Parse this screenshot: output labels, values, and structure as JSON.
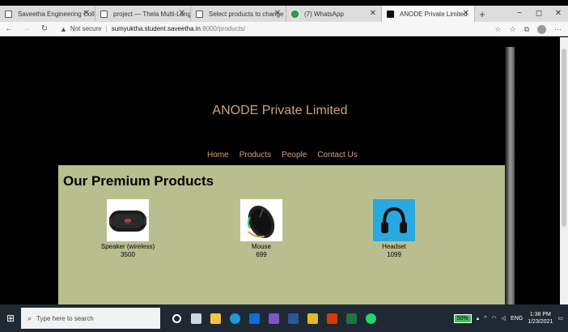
{
  "browser": {
    "tabs": [
      {
        "label": "Saveetha Engineering College",
        "icon": "page-icon",
        "active": false
      },
      {
        "label": "project — Thela Multi-Langu...",
        "icon": "page-icon",
        "active": false
      },
      {
        "label": "Select products to change | D...",
        "icon": "page-icon",
        "active": false
      },
      {
        "label": "(7) WhatsApp",
        "icon": "whatsapp-icon",
        "active": false
      },
      {
        "label": "ANODE Private Limited",
        "icon": "site-icon",
        "active": true
      }
    ],
    "new_tab": "+",
    "window_controls": {
      "minimize": "−",
      "maximize": "◻",
      "close": "✕"
    },
    "address": {
      "security_label": "Not secure",
      "host": "sumyuktha.student.saveetha.in",
      "path": ":8000/products/"
    }
  },
  "site": {
    "title": "ANODE Private Limited",
    "nav": [
      "Home",
      "Products",
      "People",
      "Contact Us"
    ],
    "section_title": "Our Premium Products",
    "products": [
      {
        "name": "Speaker (wireless)",
        "price": "3500"
      },
      {
        "name": "Mouse",
        "price": "699"
      },
      {
        "name": "Headset",
        "price": "1099"
      }
    ]
  },
  "taskbar": {
    "search_placeholder": "Type here to search",
    "battery": "50%",
    "language": "ENG",
    "time": "1:38 PM",
    "date": "1/23/2021"
  },
  "colors": {
    "site_text": "#d4a07d",
    "products_bg": "#b9be8f",
    "page_bg": "#000000"
  }
}
